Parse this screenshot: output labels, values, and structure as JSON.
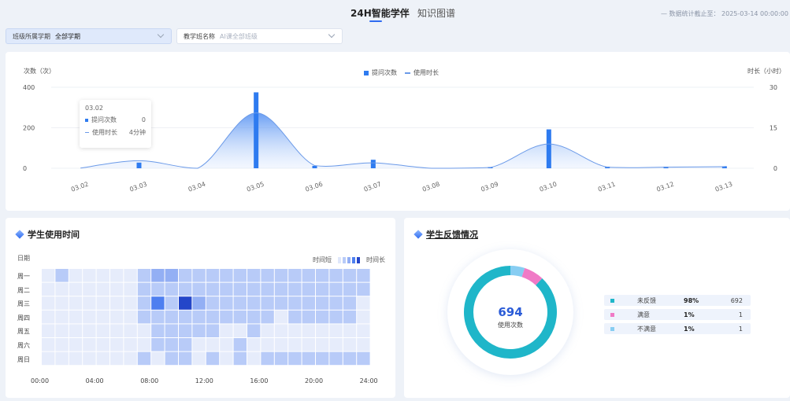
{
  "header": {
    "tabs": [
      {
        "label": "24H智能学伴",
        "active": true
      },
      {
        "label": "知识图谱",
        "active": false
      }
    ],
    "stats_stamp": "— 数据统计截止至： 2025-03-14 00:00:00"
  },
  "filters": {
    "semester": {
      "label": "班级所属学期",
      "value": "全部学期"
    },
    "class": {
      "label": "教学班名称",
      "placeholder": "AI课全部班级"
    }
  },
  "usage_chart": {
    "left_axis_label": "次数（次）",
    "right_axis_label": "时长（小时）",
    "left_ticks": [
      "400",
      "200",
      "0"
    ],
    "right_ticks": [
      "30",
      "15",
      "0"
    ],
    "legend": {
      "bar": "提问次数",
      "line": "使用时长"
    },
    "tooltip": {
      "date": "03.02",
      "bar_name": "提问次数",
      "bar_value": "0",
      "line_name": "使用时长",
      "line_value": "4分钟"
    }
  },
  "chart_data": {
    "type": "bar",
    "categories": [
      "03.02",
      "03.03",
      "03.04",
      "03.05",
      "03.06",
      "03.07",
      "03.08",
      "03.09",
      "03.10",
      "03.11",
      "03.12",
      "03.13"
    ],
    "series": [
      {
        "name": "提问次数",
        "type": "bar",
        "axis": "left",
        "values": [
          0,
          28,
          0,
          375,
          12,
          42,
          0,
          6,
          192,
          8,
          8,
          10
        ]
      },
      {
        "name": "使用时长",
        "type": "line",
        "axis": "right",
        "smooth": true,
        "values": [
          0.07,
          2.8,
          0,
          20.5,
          1,
          2,
          0,
          0.3,
          9,
          0.4,
          0.4,
          0.6
        ]
      }
    ],
    "ylim_left": [
      0,
      400
    ],
    "ylim_right": [
      0,
      30
    ],
    "ylabel_left": "次数（次）",
    "ylabel_right": "时长（小时）",
    "colors": {
      "bar": "#2e7bf0",
      "line": "#6b9ae8"
    }
  },
  "heatmap": {
    "title": "学生使用时间",
    "y_axis_label": "日期",
    "days": [
      "周一",
      "周二",
      "周三",
      "周四",
      "周五",
      "周六",
      "周日"
    ],
    "hours": [
      "00:00",
      "04:00",
      "08:00",
      "12:00",
      "16:00",
      "20:00",
      "24:00"
    ],
    "legend_low": "时间短",
    "legend_high": "时间长",
    "levels": [
      [
        0,
        1,
        0,
        0,
        0,
        0,
        0,
        1,
        2,
        2,
        1,
        1,
        1,
        1,
        1,
        1,
        1,
        1,
        1,
        1,
        1,
        1,
        1,
        1
      ],
      [
        0,
        0,
        0,
        0,
        0,
        0,
        0,
        1,
        1,
        1,
        1,
        1,
        1,
        1,
        1,
        1,
        1,
        1,
        1,
        1,
        1,
        1,
        1,
        1
      ],
      [
        0,
        0,
        0,
        0,
        0,
        0,
        0,
        1,
        3,
        1,
        4,
        2,
        1,
        1,
        1,
        1,
        1,
        1,
        1,
        1,
        1,
        1,
        1,
        0
      ],
      [
        0,
        0,
        0,
        0,
        0,
        0,
        0,
        1,
        1,
        1,
        1,
        1,
        1,
        1,
        1,
        1,
        1,
        0,
        1,
        1,
        1,
        1,
        1,
        0
      ],
      [
        0,
        0,
        0,
        0,
        0,
        0,
        0,
        0,
        1,
        1,
        1,
        1,
        1,
        0,
        0,
        1,
        0,
        0,
        0,
        0,
        0,
        0,
        0,
        0
      ],
      [
        0,
        0,
        0,
        0,
        0,
        0,
        0,
        0,
        1,
        1,
        1,
        0,
        0,
        0,
        1,
        0,
        0,
        0,
        0,
        0,
        0,
        0,
        0,
        0
      ],
      [
        0,
        0,
        0,
        0,
        0,
        0,
        0,
        1,
        0,
        1,
        1,
        0,
        1,
        0,
        1,
        0,
        1,
        1,
        1,
        1,
        1,
        1,
        1,
        1
      ]
    ],
    "colors": [
      "#e6ecfb",
      "#b8cbf8",
      "#93aff4",
      "#4e7ff0",
      "#2446c9"
    ]
  },
  "feedback": {
    "title": "学生反馈情况",
    "total": "694",
    "total_label": "使用次数",
    "items": [
      {
        "name": "未反馈",
        "pct": "98%",
        "count": "692",
        "color": "#1fb6c9"
      },
      {
        "name": "满意",
        "pct": "1%",
        "count": "1",
        "color": "#f07ac6"
      },
      {
        "name": "不满意",
        "pct": "1%",
        "count": "1",
        "color": "#87cdf2"
      }
    ]
  }
}
